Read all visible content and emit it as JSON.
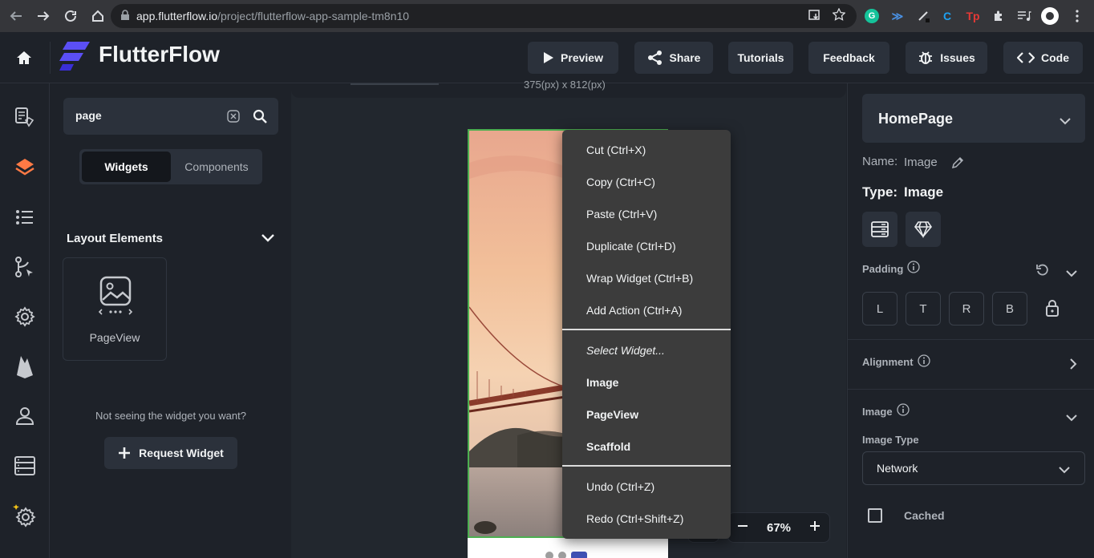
{
  "browser": {
    "url_host": "app.flutterflow.io",
    "url_path": "/project/flutterflow-app-sample-tm8n10"
  },
  "header": {
    "logo": "FlutterFlow",
    "buttons": {
      "preview": "Preview",
      "share": "Share",
      "tutorials": "Tutorials",
      "feedback": "Feedback",
      "issues": "Issues",
      "code": "Code"
    }
  },
  "widget_panel": {
    "search_value": "page",
    "tabs": {
      "widgets": "Widgets",
      "components": "Components"
    },
    "section_title": "Layout Elements",
    "widget_card_label": "PageView",
    "help_text": "Not seeing the widget you want?",
    "request_button": "Request Widget"
  },
  "canvas": {
    "top_text": "375(px) x 812(px)",
    "zoom": "67%"
  },
  "context_menu": {
    "group1": [
      "Cut (Ctrl+X)",
      "Copy (Ctrl+C)",
      "Paste (Ctrl+V)",
      "Duplicate (Ctrl+D)",
      "Wrap Widget (Ctrl+B)",
      "Add Action (Ctrl+A)"
    ],
    "select_label": "Select Widget...",
    "group2": [
      "Image",
      "PageView",
      "Scaffold"
    ],
    "group3": [
      "Undo (Ctrl+Z)",
      "Redo (Ctrl+Shift+Z)"
    ]
  },
  "properties": {
    "page_select": "HomePage",
    "name_label": "Name:",
    "name_value": "Image",
    "type_label": "Type:",
    "type_value": "Image",
    "padding_label": "Padding",
    "padding": [
      "L",
      "T",
      "R",
      "B"
    ],
    "alignment_label": "Alignment",
    "image_label": "Image",
    "image_type_label": "Image Type",
    "image_type_value": "Network",
    "cached_label": "Cached"
  },
  "colors": {
    "accent_green": "#4caf50",
    "logo_purple": "#5b4ff5",
    "layers_orange": "#ff7a45"
  }
}
